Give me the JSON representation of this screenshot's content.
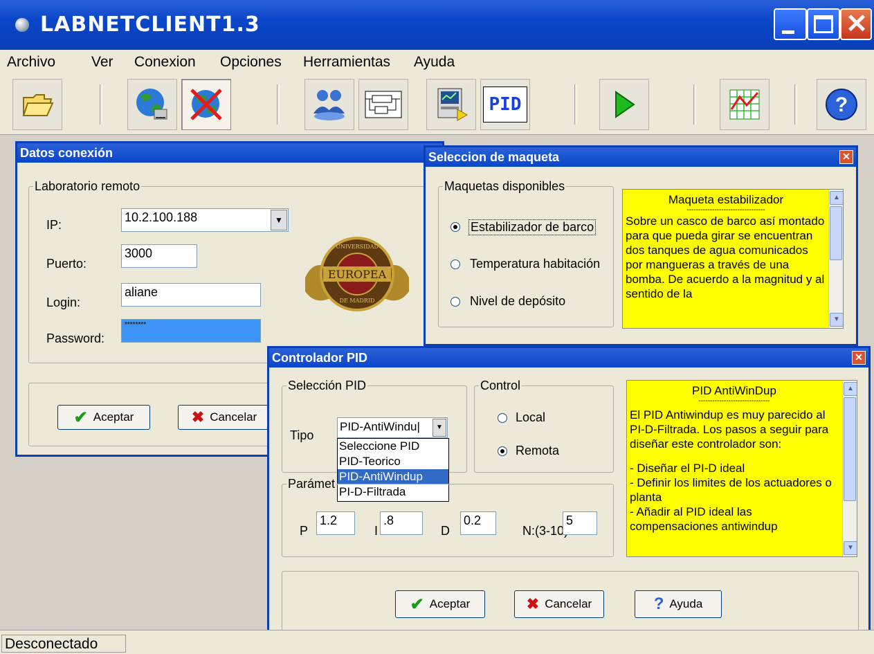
{
  "window": {
    "title": "LABNETCLIENT1.3"
  },
  "menu": {
    "items": [
      "Archivo",
      "Ver",
      "Conexion",
      "Opciones",
      "Herramientas",
      "Ayuda"
    ]
  },
  "toolbar": {
    "buttons": [
      "open-folder-icon",
      "connect-globe-icon",
      "disconnect-globe-icon",
      "users-icon",
      "block-diagram-icon",
      "monitor-icon",
      "pid-icon",
      "play-icon",
      "chart-icon",
      "help-icon"
    ],
    "pid_label": "PID"
  },
  "conexion": {
    "title": "Datos conexión",
    "group": "Laboratorio remoto",
    "ip_label": "IP:",
    "ip_value": "10.2.100.188",
    "puerto_label": "Puerto:",
    "puerto_value": "3000",
    "login_label": "Login:",
    "login_value": "aliane",
    "password_label": "Password:",
    "password_value": "********",
    "accept": "Aceptar",
    "cancel": "Cancelar",
    "logo_text_top": "UNIVERSIDAD",
    "logo_text_mid": "EUROPEA",
    "logo_text_bottom": "DE MADRID"
  },
  "maqueta": {
    "title": "Seleccion de maqueta",
    "group": "Maquetas disponibles",
    "options": [
      "Estabilizador de barco",
      "Temperatura habitación",
      "Nivel de depósito"
    ],
    "selected_index": 0,
    "info_title": "Maqueta estabilizador",
    "info_rule": "----------------------------------",
    "info_text": "Sobre un casco de barco así montado para que pueda girar se encuentran dos tanques de agua comunicados por mangueras a través de una bomba. De acuerdo a la magnitud y al sentido de la"
  },
  "pid": {
    "title": "Controlador PID",
    "sel_group": "Selección PID",
    "tipo_label": "Tipo",
    "tipo_value": "PID-AntiWindu|",
    "dropdown_options": [
      "Seleccione PID",
      "PID-Teorico",
      "PID-AntiWindup",
      "PI-D-Filtrada"
    ],
    "highlighted_option": 2,
    "control_group": "Control",
    "control_options": [
      "Local",
      "Remota"
    ],
    "control_selected": 1,
    "param_group": "Parámet",
    "p_label": "P",
    "p_value": "1.2",
    "i_label": "I",
    "i_value": ".8",
    "d_label": "D",
    "d_value": "0.2",
    "n_label": "N:(3-10)",
    "n_value": "5",
    "info_title": "PID AntiWinDup",
    "info_rule": "-------------------------------",
    "info_intro": "El PID Antiwindup es muy parecido al PI-D-Filtrada. Los pasos a seguir para diseñar este controlador son:",
    "info_steps": [
      "- Diseñar el PI-D ideal",
      "- Definir los limites de los actuadores o planta",
      "- Añadir al PID ideal las compensaciones antiwindup"
    ],
    "accept": "Aceptar",
    "cancel": "Cancelar",
    "help": "Ayuda"
  },
  "status": {
    "text": "Desconectado"
  },
  "colors": {
    "title_blue": "#0a46c9",
    "info_yellow": "#ffff00",
    "close_red": "#d9532c",
    "highlight": "#316ac5"
  }
}
